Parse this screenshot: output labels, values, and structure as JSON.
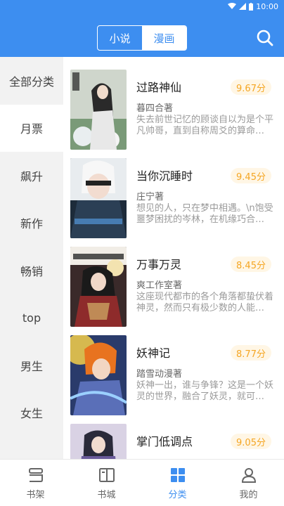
{
  "status_bar": {
    "time": "10:00"
  },
  "header": {
    "tabs": [
      {
        "label": "小说",
        "active": false
      },
      {
        "label": "漫画",
        "active": true
      }
    ],
    "search_icon": "search-icon"
  },
  "sidebar": {
    "items": [
      {
        "label": "全部分类",
        "selected": false
      },
      {
        "label": "月票",
        "selected": true
      },
      {
        "label": "飙升",
        "selected": false
      },
      {
        "label": "新作",
        "selected": false
      },
      {
        "label": "畅销",
        "selected": false
      },
      {
        "label": "top",
        "selected": false
      },
      {
        "label": "男生",
        "selected": false
      },
      {
        "label": "女生",
        "selected": false
      }
    ]
  },
  "books": [
    {
      "title": "过路神仙",
      "score": "9.67分",
      "author": "暮四合著",
      "desc": "失去前世记忆的顾谈自以为是个平凡帅哥，直到自称周爻的算命…"
    },
    {
      "title": "当你沉睡时",
      "score": "9.45分",
      "author": "庄宁著",
      "desc": "想见的人，只在梦中相遇。\\n饱受噩梦困扰的岑林，在机缘巧合…"
    },
    {
      "title": "万事万灵",
      "score": "8.45分",
      "author": "爽工作室著",
      "desc": "这座现代都市的各个角落都蛰伏着神灵，然而只有极少数的人能…"
    },
    {
      "title": "妖神记",
      "score": "8.77分",
      "author": "踏雪动漫著",
      "desc": "妖神一出，谁与争锋？这是一个妖灵的世界，融合了妖灵，就可…"
    },
    {
      "title": "掌门低调点",
      "score": "9.05分",
      "author": "",
      "desc": ""
    }
  ],
  "bottom_nav": [
    {
      "label": "书架",
      "icon": "bookshelf-icon",
      "active": false
    },
    {
      "label": "书城",
      "icon": "book-city-icon",
      "active": false
    },
    {
      "label": "分类",
      "icon": "category-grid-icon",
      "active": true
    },
    {
      "label": "我的",
      "icon": "profile-icon",
      "active": false
    }
  ],
  "colors": {
    "primary": "#3d8ef0",
    "score_text": "#f5a623",
    "score_bg": "#fff6e5"
  }
}
